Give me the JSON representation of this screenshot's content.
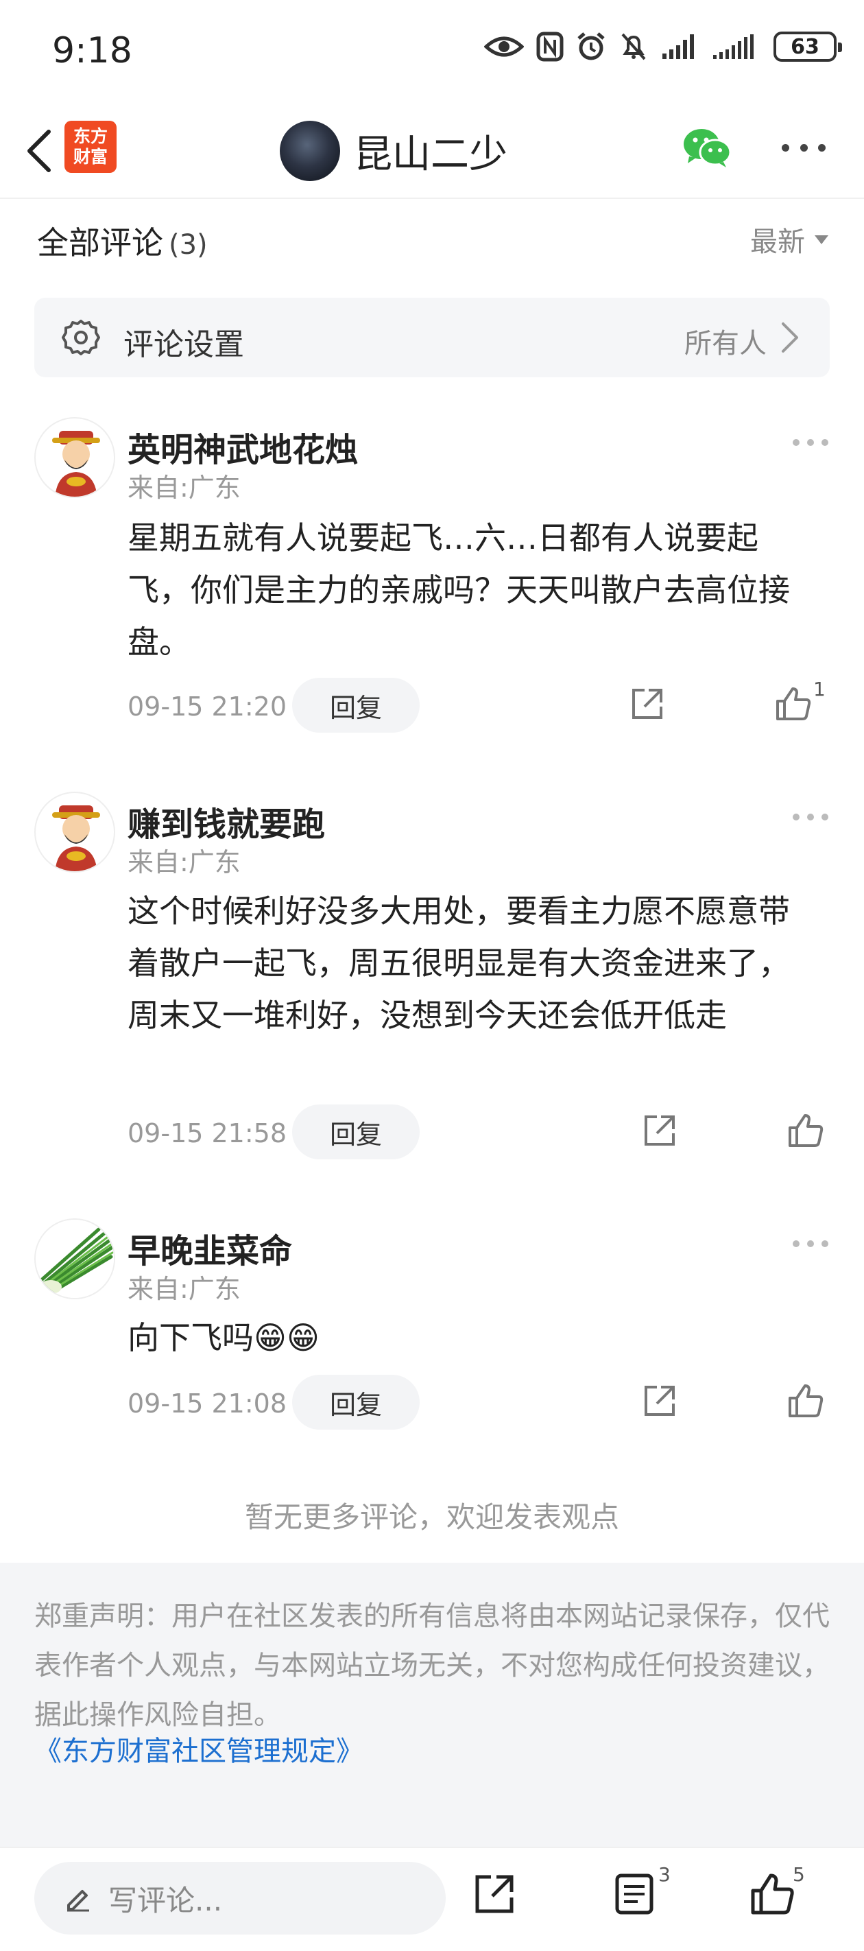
{
  "status": {
    "time": "9:18",
    "battery": "63"
  },
  "header": {
    "app_logo_line1": "东方",
    "app_logo_line2": "财富",
    "user_name": "昆山二少"
  },
  "comments_header": {
    "title": "全部评论",
    "count": "(3)",
    "sort": "最新"
  },
  "settings": {
    "label": "评论设置",
    "value": "所有人"
  },
  "comments": [
    {
      "name": "英明神武地花烛",
      "from": "来自:广东",
      "body": "星期五就有人说要起飞…六…日都有人说要起飞，你们是主力的亲戚吗？天天叫散户去高位接盘。",
      "time": "09-15 21:20",
      "reply": "回复",
      "likes": "1"
    },
    {
      "name": "赚到钱就要跑",
      "from": "来自:广东",
      "body": "这个时候利好没多大用处，要看主力愿不愿意带着散户一起飞，周五很明显是有大资金进来了，周末又一堆利好，没想到今天还会低开低走",
      "time": "09-15 21:58",
      "reply": "回复",
      "likes": ""
    },
    {
      "name": "早晚韭菜命",
      "from": "来自:广东",
      "body": "向下飞吗😁😁",
      "time": "09-15 21:08",
      "reply": "回复",
      "likes": ""
    }
  ],
  "no_more": "暂无更多评论，欢迎发表观点",
  "disclaimer": {
    "text": "郑重声明：用户在社区发表的所有信息将由本网站记录保存，仅代表作者个人观点，与本网站立场无关，不对您构成任何投资建议，据此操作风险自担。",
    "link": "《东方财富社区管理规定》"
  },
  "bottom_bar": {
    "placeholder": "写评论...",
    "comment_count": "3",
    "like_count": "5"
  },
  "colors": {
    "brand": "#f04a22",
    "link": "#1c6fd0",
    "wechat": "#3cbf4e"
  }
}
